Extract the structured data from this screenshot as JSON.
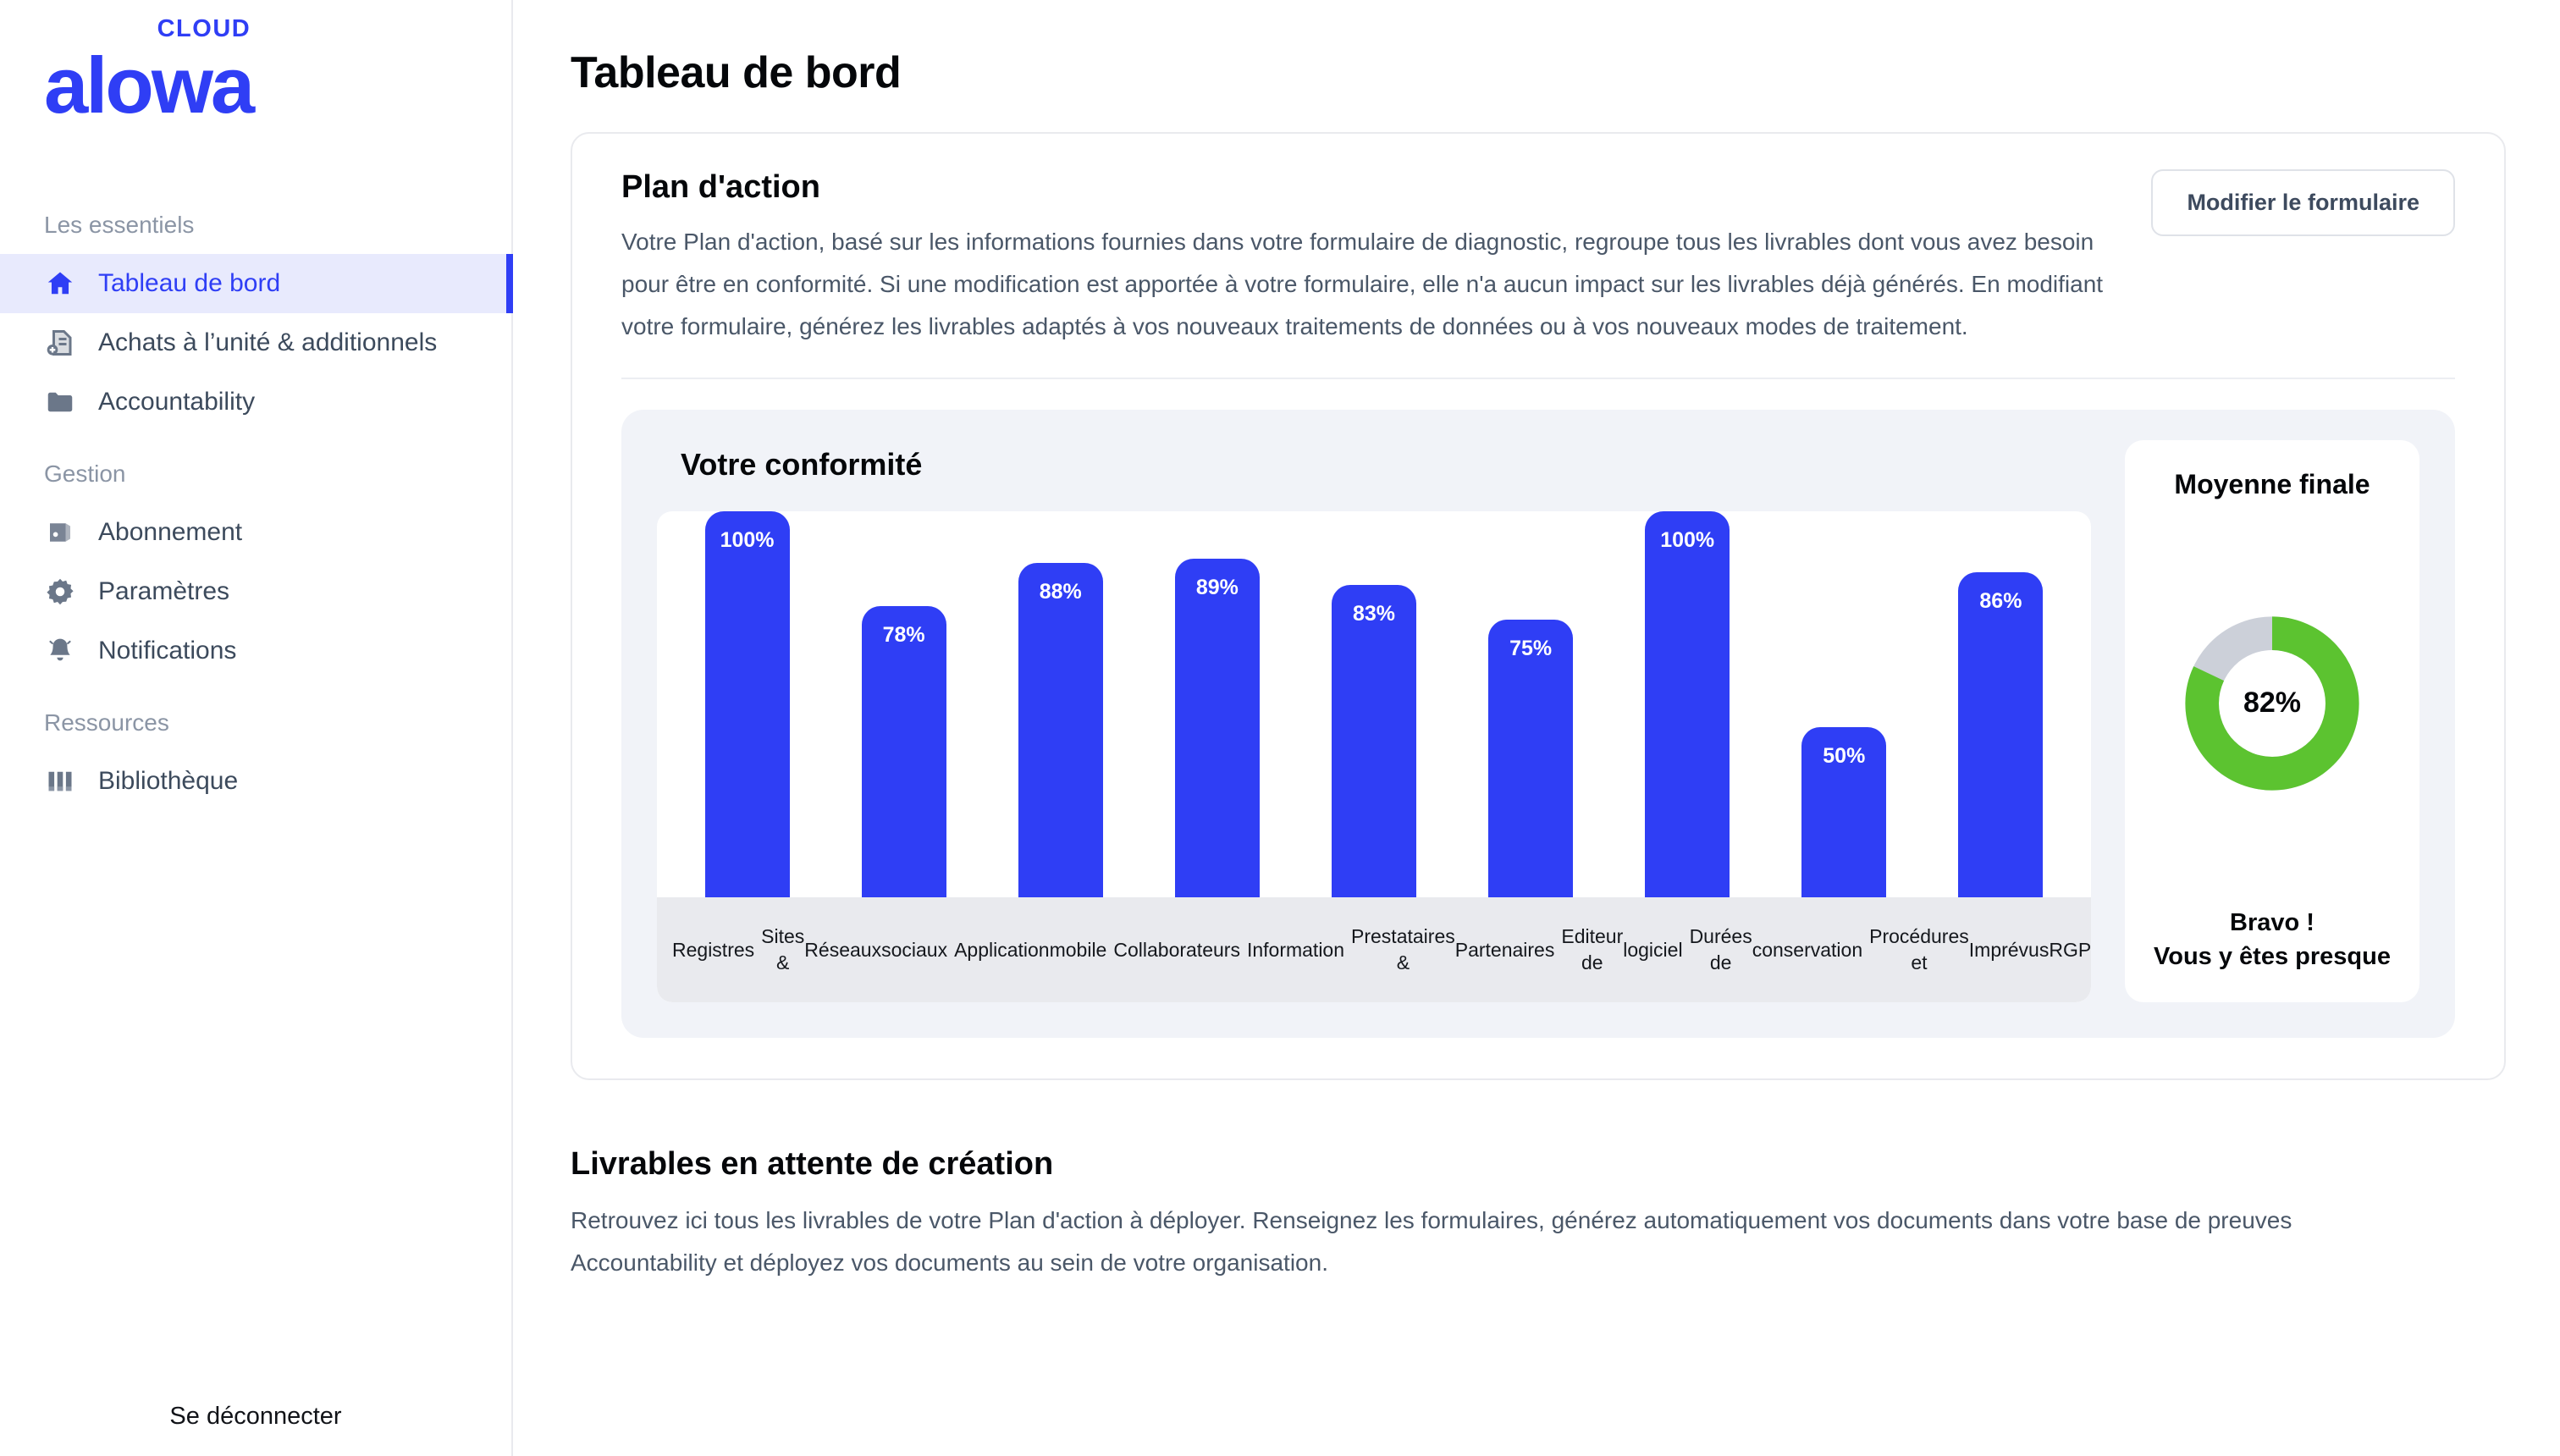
{
  "brand": {
    "name": "alowa",
    "suffix": "CLOUD",
    "color": "#2f3ef5"
  },
  "sidebar": {
    "groups": [
      {
        "title": "Les essentiels",
        "items": [
          {
            "label": "Tableau de bord",
            "icon": "home-icon",
            "active": true
          },
          {
            "label": "Achats à l’unité & additionnels",
            "icon": "document-add-icon",
            "active": false
          },
          {
            "label": "Accountability",
            "icon": "folder-icon",
            "active": false
          }
        ]
      },
      {
        "title": "Gestion",
        "items": [
          {
            "label": "Abonnement",
            "icon": "wallet-icon",
            "active": false
          },
          {
            "label": "Paramètres",
            "icon": "gear-icon",
            "active": false
          },
          {
            "label": "Notifications",
            "icon": "bell-icon",
            "active": false
          }
        ]
      },
      {
        "title": "Ressources",
        "items": [
          {
            "label": "Bibliothèque",
            "icon": "books-icon",
            "active": false
          }
        ]
      }
    ],
    "logout_label": "Se déconnecter"
  },
  "header": {
    "title": "Tableau de bord"
  },
  "plan": {
    "title": "Plan d'action",
    "description": "Votre Plan d'action, basé sur les informations fournies dans votre formulaire de diagnostic, regroupe tous les livrables dont vous avez besoin pour être en conformité. Si une modification est apportée à votre formulaire, elle n'a aucun impact sur les livrables déjà générés. En modifiant votre formulaire, générez les livrables adaptés à vos nouveaux traitements de données ou à vos nouveaux modes de traitement.",
    "edit_button": "Modifier le formulaire"
  },
  "conformity": {
    "title": "Votre conformité",
    "gauge": {
      "title": "Moyenne finale",
      "value_label": "82%",
      "caption_line1": "Bravo !",
      "caption_line2": "Vous y êtes presque",
      "arc_color": "#5cc330",
      "track_color": "#ccd0d9"
    }
  },
  "deliverables": {
    "title": "Livrables en attente de création",
    "description": "Retrouvez ici tous les livrables de votre Plan d'action à déployer. Renseignez les formulaires, générez automatiquement vos documents dans votre base de preuves Accountability et déployez vos documents au sein de votre organisation."
  },
  "chart_data": {
    "type": "bar",
    "title": "Votre conformité",
    "xlabel": "",
    "ylabel": "",
    "ylim": [
      0,
      100
    ],
    "grid": false,
    "legend": "none",
    "bar_color": "#2f3ef5",
    "categories": [
      "Registres",
      "Sites & Réseaux sociaux",
      "Application mobile",
      "Collaborateurs",
      "Information",
      "Prestataires & Partenaires",
      "Editeur de logiciel",
      "Durées de conservation",
      "Procédures et Imprévus RGPD"
    ],
    "category_lines": [
      [
        "Registres"
      ],
      [
        "Sites &",
        "Réseaux",
        "sociaux"
      ],
      [
        "Application",
        "mobile"
      ],
      [
        "Collaborateurs"
      ],
      [
        "Information"
      ],
      [
        "Prestataires &",
        "Partenaires"
      ],
      [
        "Editeur de",
        "logiciel"
      ],
      [
        "Durées de",
        "conservation"
      ],
      [
        "Procédures et",
        "Imprévus",
        "RGPD"
      ]
    ],
    "values": [
      100,
      78,
      88,
      89,
      83,
      75,
      100,
      50,
      86
    ],
    "value_labels": [
      "100%",
      "78%",
      "88%",
      "89%",
      "83%",
      "75%",
      "100%",
      "50%",
      "86%"
    ],
    "gauge": {
      "type": "donut",
      "value": 82,
      "max": 100,
      "label": "82%"
    }
  }
}
